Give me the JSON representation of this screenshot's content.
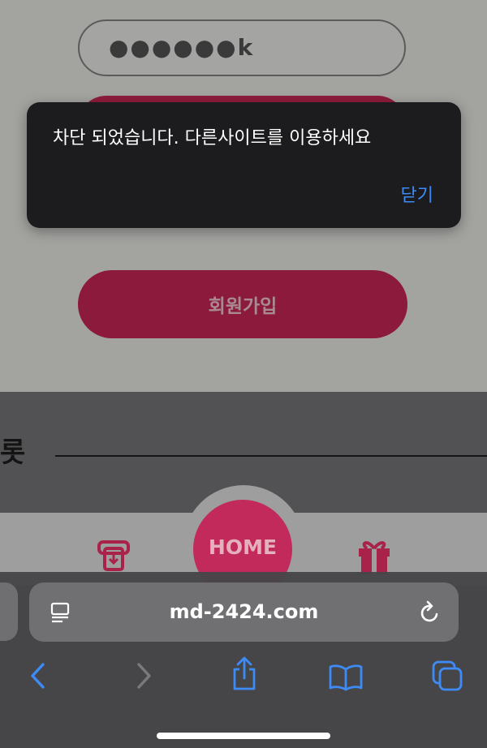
{
  "page": {
    "password_masked": "●●●●●●k",
    "signup_label": "회원가입",
    "section_heading": "롯",
    "home_label": "HOME"
  },
  "alert": {
    "message": "차단 되었습니다. 다른사이트를 이용하세요",
    "close_label": "닫기"
  },
  "browser": {
    "url": "md-2424.com"
  },
  "colors": {
    "accent": "#3d8bf7",
    "brand": "#c12a5b",
    "signup": "#8c1a3c"
  },
  "icons": [
    "reader-icon",
    "reload-icon",
    "back-icon",
    "forward-icon",
    "share-icon",
    "bookmarks-icon",
    "tabs-icon",
    "withdraw-icon",
    "gift-icon",
    "tab-icon-partial"
  ]
}
